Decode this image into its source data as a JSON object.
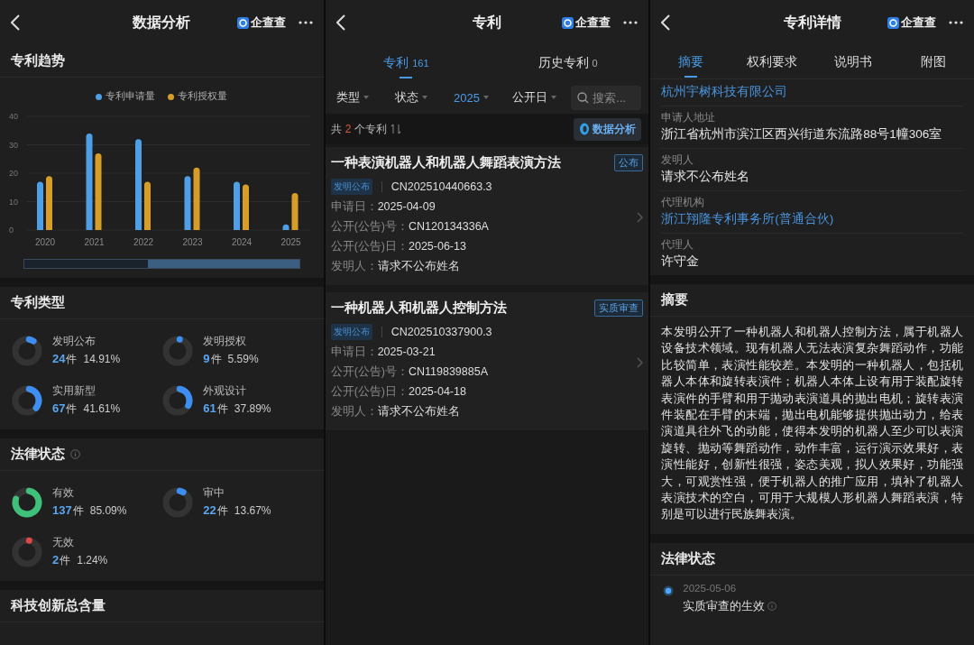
{
  "analysis_screen": {
    "header": {
      "title": "数据分析",
      "brand": "企查查"
    },
    "trend": {
      "title": "专利趋势",
      "chart_data": {
        "type": "bar",
        "categories": [
          "2020",
          "2021",
          "2022",
          "2023",
          "2024",
          "2025"
        ],
        "ylim": [
          0,
          40
        ],
        "yticks": [
          0,
          10,
          20,
          30,
          40
        ],
        "series": [
          {
            "name": "专利申请量",
            "color": "#4f9fe6",
            "values": [
              17,
              34,
              32,
              19,
              17,
              2
            ]
          },
          {
            "name": "专利授权量",
            "color": "#d69e28",
            "values": [
              19,
              27,
              17,
              22,
              16,
              13
            ]
          }
        ]
      }
    },
    "patent_types": {
      "title": "专利类型",
      "items": [
        {
          "label": "发明公布",
          "count": "24",
          "unit": "件",
          "percent": "14.91%",
          "level": 0.1491,
          "color": "#3d8ef0"
        },
        {
          "label": "发明授权",
          "count": "9",
          "unit": "件",
          "percent": "5.59%",
          "level": 0.0559,
          "color": "#3d8ef0"
        },
        {
          "label": "实用新型",
          "count": "67",
          "unit": "件",
          "percent": "41.61%",
          "level": 0.4161,
          "color": "#3d8ef0"
        },
        {
          "label": "外观设计",
          "count": "61",
          "unit": "件",
          "percent": "37.89%",
          "level": 0.3789,
          "color": "#3d8ef0"
        }
      ]
    },
    "legal_status": {
      "title": "法律状态",
      "items": [
        {
          "label": "有效",
          "count": "137",
          "unit": "件",
          "percent": "85.09%",
          "level": 0.8509,
          "color": "#3fc07a"
        },
        {
          "label": "审中",
          "count": "22",
          "unit": "件",
          "percent": "13.67%",
          "level": 0.1367,
          "color": "#3d8ef0"
        },
        {
          "label": "无效",
          "count": "2",
          "unit": "件",
          "percent": "1.24%",
          "level": 0.0124,
          "color": "#e04848"
        }
      ]
    },
    "innovation": {
      "title": "科技创新总含量"
    }
  },
  "patent_list_screen": {
    "header": {
      "title": "专利",
      "brand": "企查查"
    },
    "tabs": [
      {
        "label": "专利",
        "count": "161",
        "selected": true
      },
      {
        "label": "历史专利",
        "count": "0",
        "selected": false
      }
    ],
    "filters": [
      {
        "label": "类型",
        "selected": false
      },
      {
        "label": "状态",
        "selected": false
      },
      {
        "label": "2025",
        "selected": true
      },
      {
        "label": "公开日",
        "selected": false
      }
    ],
    "search": {
      "placeholder": "搜索..."
    },
    "summary": {
      "prefix": "共",
      "count": "2",
      "suffix": "个专利",
      "button": "数据分析"
    },
    "patents": [
      {
        "title": "一种表演机器人和机器人舞蹈表演方法",
        "status": "公布",
        "type_tag": "发明公布",
        "number": "CN202510440663.3",
        "fields": [
          {
            "label": "申请日：",
            "value": "2025-04-09"
          },
          {
            "label": "公开(公告)号：",
            "value": "CN120134336A"
          },
          {
            "label": "公开(公告)日：",
            "value": "2025-06-13"
          },
          {
            "label": "发明人：",
            "value": "请求不公布姓名"
          }
        ]
      },
      {
        "title": "一种机器人和机器人控制方法",
        "status": "实质审查",
        "type_tag": "发明公布",
        "number": "CN202510337900.3",
        "fields": [
          {
            "label": "申请日：",
            "value": "2025-03-21"
          },
          {
            "label": "公开(公告)号：",
            "value": "CN119839885A"
          },
          {
            "label": "公开(公告)日：",
            "value": "2025-04-18"
          },
          {
            "label": "发明人：",
            "value": "请求不公布姓名"
          }
        ]
      }
    ]
  },
  "patent_detail_screen": {
    "header": {
      "title": "专利详情",
      "brand": "企查查"
    },
    "tabs": [
      {
        "label": "摘要",
        "selected": true
      },
      {
        "label": "权利要求",
        "selected": false
      },
      {
        "label": "说明书",
        "selected": false
      },
      {
        "label": "附图",
        "selected": false
      }
    ],
    "fields": [
      {
        "value": "杭州宇树科技有限公司",
        "link": true
      },
      {
        "label": "申请人地址",
        "value": "浙江省杭州市滨江区西兴街道东流路88号1幢306室",
        "link": false
      },
      {
        "label": "发明人",
        "value": "请求不公布姓名",
        "link": false
      },
      {
        "label": "代理机构",
        "value": "浙江翔隆专利事务所(普通合伙)",
        "link": true
      },
      {
        "label": "代理人",
        "value": "许守金",
        "link": false
      }
    ],
    "abstract": {
      "title": "摘要",
      "text": "本发明公开了一种机器人和机器人控制方法，属于机器人设备技术领域。现有机器人无法表演复杂舞蹈动作，功能比较简单，表演性能较差。本发明的一种机器人，包括机器人本体和旋转表演件；机器人本体上设有用于装配旋转表演件的手臂和用于抛动表演道具的抛出电机；旋转表演件装配在手臂的末端，抛出电机能够提供抛出动力，给表演道具往外飞的动能，使得本发明的机器人至少可以表演旋转、抛动等舞蹈动作，动作丰富，运行演示效果好，表演性能好，创新性很强，姿态美观，拟人效果好，功能强大，可观赏性强，便于机器人的推广应用，填补了机器人表演技术的空白，可用于大规模人形机器人舞蹈表演，特别是可以进行民族舞表演。"
    },
    "legal_status": {
      "title": "法律状态",
      "events": [
        {
          "date": "2025-05-06",
          "text": "实质审查的生效"
        }
      ]
    }
  }
}
